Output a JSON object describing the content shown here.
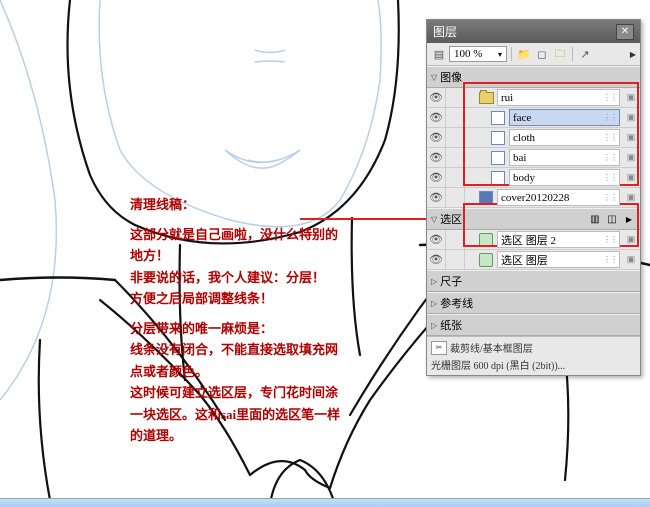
{
  "panel": {
    "title": "图层",
    "zoom": "100 %",
    "groups": {
      "image": "图像",
      "selection": "选区",
      "ruler": "尺子",
      "guide": "参考线",
      "paper": "纸张"
    },
    "layers": {
      "rui": "rui",
      "face": "face",
      "cloth": "cloth",
      "bai": "bai",
      "body": "body",
      "cover": "cover20120228",
      "sel2": "选区 图层 2",
      "sel1": "选区 图层"
    },
    "footer1": "裁剪线/基本框图层",
    "footer2": "光栅图层  600 dpi (黑白 (2bit))..."
  },
  "ann": {
    "l1": "清理线稿：",
    "l2": "这部分就是自己画啦，没什么特别的",
    "l3": "地方！",
    "l4": "非要说的话，我个人建议：分层！",
    "l5": "方便之后局部调整线条！",
    "l6": "分层带来的唯一麻烦是：",
    "l7": "线条没有闭合，不能直接选取填充网",
    "l8": "点或者颜色。",
    "l9": "这时候可建立选区层，专门花时间涂",
    "l10": "一块选区。这和sai里面的选区笔一样",
    "l11": "的道理。"
  }
}
